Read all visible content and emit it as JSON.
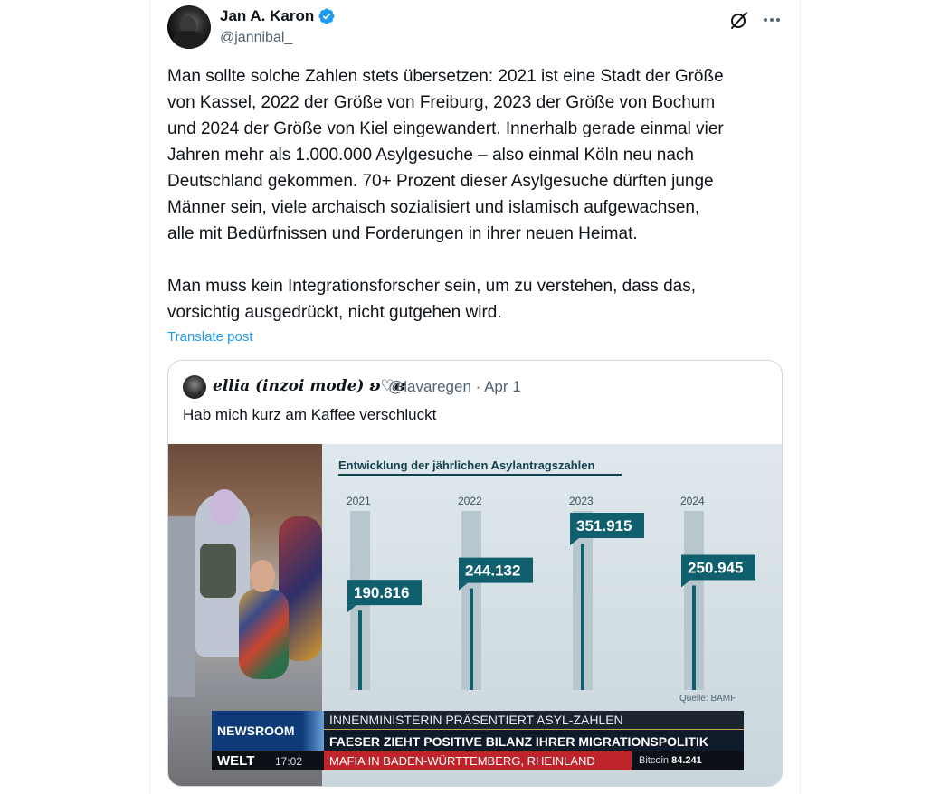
{
  "author": {
    "name": "Jan A. Karon",
    "handle": "@jannibal_"
  },
  "icons": {
    "verified": "verified-badge-icon",
    "grok": "grok-icon",
    "more": "more-options-icon"
  },
  "tweet": {
    "text": "Man sollte solche Zahlen stets übersetzen: 2021 ist eine Stadt der Größe\nvon Kassel, 2022 der Größe von Freiburg, 2023 der Größe von Bochum\nund 2024 der Größe von Kiel eingewandert. Innerhalb gerade einmal vier\nJahren mehr als 1.000.000 Asylgesuche – also einmal Köln neu nach\nDeutschland gekommen. 70+ Prozent dieser Asylgesuche dürften junge\nMänner sein, viele archaisch sozialisiert und islamisch aufgewachsen,\nalle mit Bedürfnissen und Forderungen in ihrer neuen Heimat.\n\nMan muss kein Integrationsforscher sein, um zu verstehen, dass das,\nvorsichtig ausgedrückt, nicht gutgehen wird.",
    "translate_label": "Translate post"
  },
  "quote": {
    "name": "ellia (inzoi mode) ʚ♡ɞ",
    "handle_date": "@lavaregen · Apr 1",
    "text": "Hab mich kurz am Kaffee verschluckt"
  },
  "chart_data": {
    "type": "bar",
    "title": "Entwicklung der jährlichen Asylantragszahlen",
    "categories": [
      "2021",
      "2022",
      "2023",
      "2024"
    ],
    "values": [
      190816,
      244132,
      351915,
      250945
    ],
    "value_labels": [
      "190.816",
      "244.132",
      "351.915",
      "250.945"
    ],
    "ylim": [
      0,
      351915
    ],
    "source": "Quelle: BAMF",
    "colors": {
      "bar": "#0f5f6e",
      "track": "#b8c7cd",
      "label_bg": "#0f5f6e",
      "label_text": "#ffffff",
      "year_text": "#3f5661"
    }
  },
  "ticker": {
    "newsroom": "NEWSROOM",
    "headline1": "INNENMINISTERIN PRÄSENTIERT ASYL-ZAHLEN",
    "headline2": "FAESER ZIEHT POSITIVE BILANZ IHRER MIGRATIONSPOLITIK",
    "channel": "WELT",
    "time": "17:02",
    "crawl": "MAFIA IN BADEN-WÜRTTEMBERG, RHEINLAND",
    "btc_label": "Bitcoin",
    "btc_value": "84.241"
  }
}
